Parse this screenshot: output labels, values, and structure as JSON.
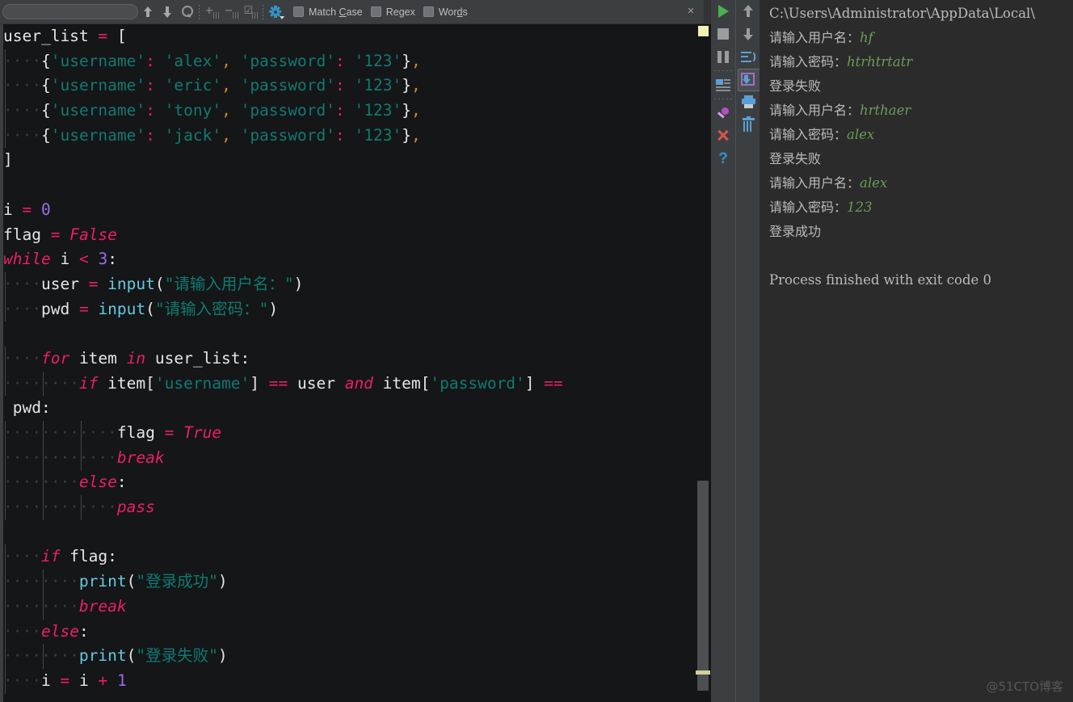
{
  "find_bar": {
    "search_value": "",
    "search_placeholder": "",
    "buttons": [
      {
        "name": "find-previous",
        "icon": "arrow-up-icon"
      },
      {
        "name": "find-next",
        "icon": "arrow-down-icon"
      },
      {
        "name": "find-in-selection",
        "icon": "magnifier-icon"
      },
      {
        "name": "add-occurrence",
        "icon": "plus-lines-icon"
      },
      {
        "name": "remove-occurrence",
        "icon": "minus-lines-icon"
      },
      {
        "name": "select-all-occurrences",
        "icon": "check-lines-icon"
      },
      {
        "name": "find-settings",
        "icon": "gear-icon"
      }
    ],
    "checkboxes": [
      {
        "label_pre": "Match ",
        "label_mn": "C",
        "label_post": "ase",
        "checked": false
      },
      {
        "label_pre": "Re",
        "label_mn": "g",
        "label_post": "ex",
        "checked": false
      },
      {
        "label_pre": "Wor",
        "label_mn": "d",
        "label_post": "s",
        "checked": false
      }
    ],
    "close_label": "×"
  },
  "editor": {
    "language": "python",
    "lines": [
      [
        {
          "t": "user_list ",
          "c": "def"
        },
        {
          "t": "=",
          "c": "op"
        },
        {
          "t": " ",
          "c": "def"
        },
        {
          "t": "[",
          "c": "brace"
        }
      ],
      [
        {
          "t": "····",
          "c": "wsp"
        },
        {
          "t": "{",
          "c": "brace"
        },
        {
          "t": "'username'",
          "c": "str"
        },
        {
          "t": ":",
          "c": "op"
        },
        {
          "t": " ",
          "c": "def"
        },
        {
          "t": "'alex'",
          "c": "str"
        },
        {
          "t": ",",
          "c": "comma"
        },
        {
          "t": " ",
          "c": "def"
        },
        {
          "t": "'password'",
          "c": "str"
        },
        {
          "t": ":",
          "c": "op"
        },
        {
          "t": " ",
          "c": "def"
        },
        {
          "t": "'123'",
          "c": "str"
        },
        {
          "t": "}",
          "c": "brace"
        },
        {
          "t": ",",
          "c": "comma"
        }
      ],
      [
        {
          "t": "····",
          "c": "wsp"
        },
        {
          "t": "{",
          "c": "brace"
        },
        {
          "t": "'username'",
          "c": "str"
        },
        {
          "t": ":",
          "c": "op"
        },
        {
          "t": " ",
          "c": "def"
        },
        {
          "t": "'eric'",
          "c": "str"
        },
        {
          "t": ",",
          "c": "comma"
        },
        {
          "t": " ",
          "c": "def"
        },
        {
          "t": "'password'",
          "c": "str"
        },
        {
          "t": ":",
          "c": "op"
        },
        {
          "t": " ",
          "c": "def"
        },
        {
          "t": "'123'",
          "c": "str"
        },
        {
          "t": "}",
          "c": "brace"
        },
        {
          "t": ",",
          "c": "comma"
        }
      ],
      [
        {
          "t": "····",
          "c": "wsp"
        },
        {
          "t": "{",
          "c": "brace"
        },
        {
          "t": "'username'",
          "c": "str"
        },
        {
          "t": ":",
          "c": "op"
        },
        {
          "t": " ",
          "c": "def"
        },
        {
          "t": "'tony'",
          "c": "str"
        },
        {
          "t": ",",
          "c": "comma"
        },
        {
          "t": " ",
          "c": "def"
        },
        {
          "t": "'password'",
          "c": "str"
        },
        {
          "t": ":",
          "c": "op"
        },
        {
          "t": " ",
          "c": "def"
        },
        {
          "t": "'123'",
          "c": "str"
        },
        {
          "t": "}",
          "c": "brace"
        },
        {
          "t": ",",
          "c": "comma"
        }
      ],
      [
        {
          "t": "····",
          "c": "wsp"
        },
        {
          "t": "{",
          "c": "brace"
        },
        {
          "t": "'username'",
          "c": "str"
        },
        {
          "t": ":",
          "c": "op"
        },
        {
          "t": " ",
          "c": "def"
        },
        {
          "t": "'jack'",
          "c": "str"
        },
        {
          "t": ",",
          "c": "comma"
        },
        {
          "t": " ",
          "c": "def"
        },
        {
          "t": "'password'",
          "c": "str"
        },
        {
          "t": ":",
          "c": "op"
        },
        {
          "t": " ",
          "c": "def"
        },
        {
          "t": "'123'",
          "c": "str"
        },
        {
          "t": "}",
          "c": "brace"
        },
        {
          "t": ",",
          "c": "comma"
        }
      ],
      [
        {
          "t": "]",
          "c": "brace"
        }
      ],
      [],
      [
        {
          "t": "i ",
          "c": "def"
        },
        {
          "t": "=",
          "c": "op"
        },
        {
          "t": " ",
          "c": "def"
        },
        {
          "t": "0",
          "c": "num"
        }
      ],
      [
        {
          "t": "flag ",
          "c": "def"
        },
        {
          "t": "=",
          "c": "op"
        },
        {
          "t": " ",
          "c": "def"
        },
        {
          "t": "False",
          "c": "kw"
        }
      ],
      [
        {
          "t": "while",
          "c": "kw"
        },
        {
          "t": " i ",
          "c": "def"
        },
        {
          "t": "<",
          "c": "op"
        },
        {
          "t": " ",
          "c": "def"
        },
        {
          "t": "3",
          "c": "num"
        },
        {
          "t": ":",
          "c": "punct"
        }
      ],
      [
        {
          "t": "····",
          "c": "wsp"
        },
        {
          "t": "user ",
          "c": "def"
        },
        {
          "t": "=",
          "c": "op"
        },
        {
          "t": " ",
          "c": "def"
        },
        {
          "t": "input",
          "c": "fn"
        },
        {
          "t": "(",
          "c": "punct"
        },
        {
          "t": "\"请输入用户名：\"",
          "c": "str"
        },
        {
          "t": ")",
          "c": "punct"
        }
      ],
      [
        {
          "t": "····",
          "c": "wsp"
        },
        {
          "t": "pwd ",
          "c": "def"
        },
        {
          "t": "=",
          "c": "op"
        },
        {
          "t": " ",
          "c": "def"
        },
        {
          "t": "input",
          "c": "fn"
        },
        {
          "t": "(",
          "c": "punct"
        },
        {
          "t": "\"请输入密码：\"",
          "c": "str"
        },
        {
          "t": ")",
          "c": "punct"
        }
      ],
      [],
      [
        {
          "t": "····",
          "c": "wsp"
        },
        {
          "t": "for",
          "c": "kw"
        },
        {
          "t": " item ",
          "c": "def"
        },
        {
          "t": "in",
          "c": "kw"
        },
        {
          "t": " user_list",
          "c": "def"
        },
        {
          "t": ":",
          "c": "punct"
        }
      ],
      [
        {
          "t": "········",
          "c": "wsp"
        },
        {
          "t": "if",
          "c": "kw"
        },
        {
          "t": " item",
          "c": "def"
        },
        {
          "t": "[",
          "c": "punct"
        },
        {
          "t": "'username'",
          "c": "str"
        },
        {
          "t": "]",
          "c": "punct"
        },
        {
          "t": " ",
          "c": "def"
        },
        {
          "t": "==",
          "c": "op"
        },
        {
          "t": " user ",
          "c": "def"
        },
        {
          "t": "and",
          "c": "kw"
        },
        {
          "t": " item",
          "c": "def"
        },
        {
          "t": "[",
          "c": "punct"
        },
        {
          "t": "'password'",
          "c": "str"
        },
        {
          "t": "]",
          "c": "punct"
        },
        {
          "t": " ",
          "c": "def"
        },
        {
          "t": "==",
          "c": "op"
        }
      ],
      [
        {
          "t": " pwd",
          "c": "def"
        },
        {
          "t": ":",
          "c": "punct"
        }
      ],
      [
        {
          "t": "············",
          "c": "wsp"
        },
        {
          "t": "flag ",
          "c": "def"
        },
        {
          "t": "=",
          "c": "op"
        },
        {
          "t": " ",
          "c": "def"
        },
        {
          "t": "True",
          "c": "kw"
        }
      ],
      [
        {
          "t": "············",
          "c": "wsp"
        },
        {
          "t": "break",
          "c": "kw"
        }
      ],
      [
        {
          "t": "········",
          "c": "wsp"
        },
        {
          "t": "else",
          "c": "kw"
        },
        {
          "t": ":",
          "c": "punct"
        }
      ],
      [
        {
          "t": "············",
          "c": "wsp"
        },
        {
          "t": "pass",
          "c": "kw"
        }
      ],
      [],
      [
        {
          "t": "····",
          "c": "wsp"
        },
        {
          "t": "if",
          "c": "kw"
        },
        {
          "t": " flag",
          "c": "def"
        },
        {
          "t": ":",
          "c": "punct"
        }
      ],
      [
        {
          "t": "········",
          "c": "wsp"
        },
        {
          "t": "print",
          "c": "fn"
        },
        {
          "t": "(",
          "c": "punct"
        },
        {
          "t": "\"登录成功\"",
          "c": "str"
        },
        {
          "t": ")",
          "c": "punct"
        }
      ],
      [
        {
          "t": "········",
          "c": "wsp"
        },
        {
          "t": "break",
          "c": "kw"
        }
      ],
      [
        {
          "t": "····",
          "c": "wsp"
        },
        {
          "t": "else",
          "c": "kw"
        },
        {
          "t": ":",
          "c": "punct"
        }
      ],
      [
        {
          "t": "········",
          "c": "wsp"
        },
        {
          "t": "print",
          "c": "fn"
        },
        {
          "t": "(",
          "c": "punct"
        },
        {
          "t": "\"登录失败\"",
          "c": "str"
        },
        {
          "t": ")",
          "c": "punct"
        }
      ],
      [
        {
          "t": "····",
          "c": "wsp"
        },
        {
          "t": "i ",
          "c": "def"
        },
        {
          "t": "=",
          "c": "op"
        },
        {
          "t": " i ",
          "c": "def"
        },
        {
          "t": "+",
          "c": "op"
        },
        {
          "t": " ",
          "c": "def"
        },
        {
          "t": "1",
          "c": "num"
        }
      ]
    ]
  },
  "run_toolbar": {
    "left_buttons": [
      {
        "name": "rerun-button",
        "icon": "play-icon"
      },
      {
        "name": "stop-button",
        "icon": "stop-icon"
      },
      {
        "name": "pause-button",
        "icon": "pause-icon"
      },
      {
        "name": "show-console-button",
        "icon": "console-icon"
      },
      {
        "name": "pin-tab-button",
        "icon": "pin-icon"
      },
      {
        "name": "close-tab-button",
        "icon": "close-x-icon"
      },
      {
        "name": "help-button",
        "icon": "question-mark-icon"
      }
    ],
    "right_buttons": [
      {
        "name": "scroll-up-button",
        "icon": "arrow-up-icon"
      },
      {
        "name": "scroll-down-button",
        "icon": "arrow-down-icon"
      },
      {
        "name": "soft-wrap-button",
        "icon": "wrap-lines-icon"
      },
      {
        "name": "scroll-to-end-button",
        "icon": "scroll-to-end-icon",
        "selected": true
      },
      {
        "name": "print-button",
        "icon": "printer-icon"
      },
      {
        "name": "clear-all-button",
        "icon": "trash-icon"
      }
    ]
  },
  "console": {
    "lines": [
      [
        {
          "t": "C:\\Users\\Administrator\\AppData\\Local\\",
          "c": "n"
        }
      ],
      [
        {
          "t": "请输入用户名：",
          "c": "cjk"
        },
        {
          "t": "hf",
          "c": "g"
        }
      ],
      [
        {
          "t": "请输入密码：",
          "c": "cjk"
        },
        {
          "t": "htrhtrtatr",
          "c": "g"
        }
      ],
      [
        {
          "t": "登录失败",
          "c": "cjk"
        }
      ],
      [
        {
          "t": "请输入用户名：",
          "c": "cjk"
        },
        {
          "t": "hrthaer",
          "c": "g"
        }
      ],
      [
        {
          "t": "请输入密码：",
          "c": "cjk"
        },
        {
          "t": "alex",
          "c": "g"
        }
      ],
      [
        {
          "t": "登录失败",
          "c": "cjk"
        }
      ],
      [
        {
          "t": "请输入用户名：",
          "c": "cjk"
        },
        {
          "t": "alex",
          "c": "g"
        }
      ],
      [
        {
          "t": "请输入密码：",
          "c": "cjk"
        },
        {
          "t": "123",
          "c": "g"
        }
      ],
      [
        {
          "t": "登录成功",
          "c": "cjk"
        }
      ],
      [],
      [
        {
          "t": "Process finished with exit code 0",
          "c": "n"
        }
      ]
    ]
  },
  "watermark": {
    "text": "@51CTO博客"
  },
  "colors": {
    "editor_bg": "#151617",
    "console_bg": "#2b2b2b",
    "chrome_bg": "#3c3f41",
    "keyword": "#ec1e63",
    "string": "#0f7a72",
    "number": "#9a6ee8",
    "function": "#64c8e0",
    "default_text": "#e6e6e6",
    "console_text": "#bbbbbb",
    "console_input": "#6a9c55",
    "accent_blue": "#3592c4",
    "run_green": "#4caf50"
  }
}
